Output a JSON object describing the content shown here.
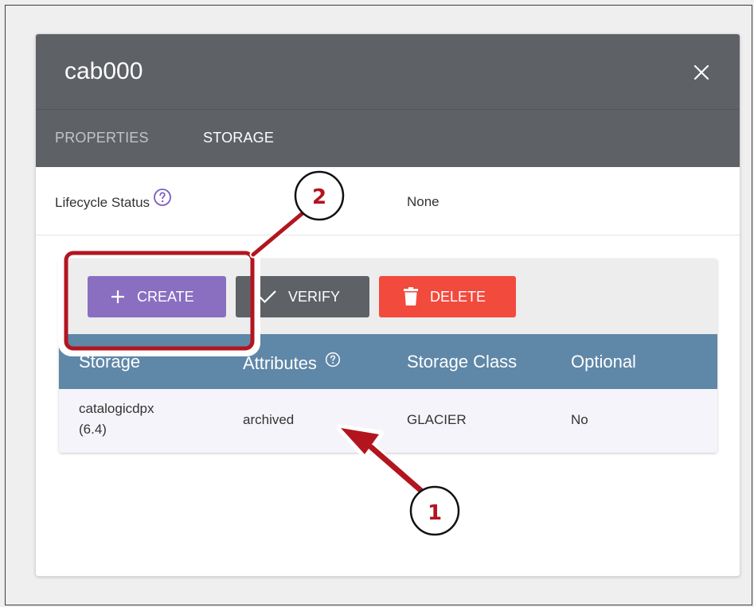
{
  "dialog": {
    "title": "cab000",
    "close_icon": "close-icon"
  },
  "tabs": [
    {
      "label": "PROPERTIES",
      "active": false
    },
    {
      "label": "STORAGE",
      "active": true
    }
  ],
  "lifecycle": {
    "label": "Lifecycle Status",
    "value": "None",
    "help_icon": "help-circle-icon"
  },
  "toolbar": {
    "create_label": "CREATE",
    "verify_label": "VERIFY",
    "delete_label": "DELETE",
    "create_icon": "plus-icon",
    "verify_icon": "check-icon",
    "delete_icon": "trash-icon"
  },
  "table": {
    "columns": [
      "Storage",
      "Attributes",
      "Storage Class",
      "Optional"
    ],
    "rows": [
      {
        "storage_name": "catalogicdpx",
        "storage_version": "(6.4)",
        "attributes": "archived",
        "storage_class": "GLACIER",
        "optional": "No"
      }
    ]
  },
  "annotations": {
    "callout_1": "1",
    "callout_2": "2"
  },
  "colors": {
    "header_bg": "#5e6166",
    "table_header_bg": "#5f87a8",
    "create_btn": "#8a6fc1",
    "verify_btn": "#5e6166",
    "delete_btn": "#f24a3d",
    "help_icon": "#7b5cc4",
    "annotation": "#b3151f"
  }
}
